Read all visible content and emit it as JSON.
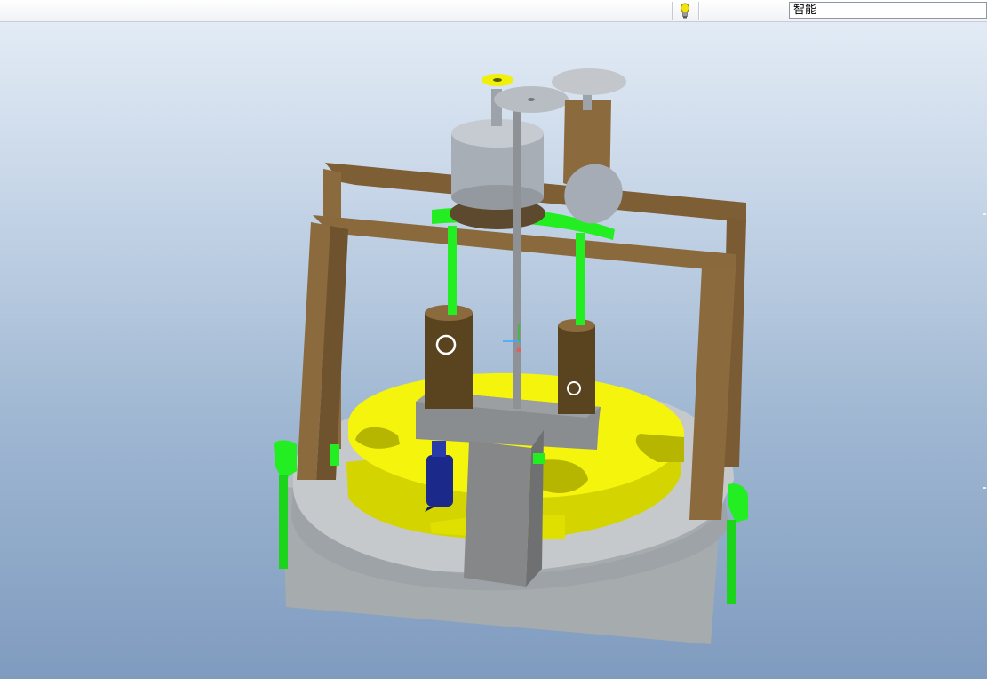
{
  "toolbar": {
    "status_icon": "lightbulb-icon",
    "filter_value": "智能"
  },
  "viewport": {
    "model": "3d-mechanical-assembly",
    "colors": {
      "background_top": "#e6eef7",
      "background_bottom": "#7f9bbf",
      "frame": "#8b6a3e",
      "link_arm": "#22ee22",
      "indexing_plate": "#f2f20a",
      "base": "#a9adb0",
      "motor": "#aab0b8",
      "tool": "#1c2a8c"
    }
  }
}
